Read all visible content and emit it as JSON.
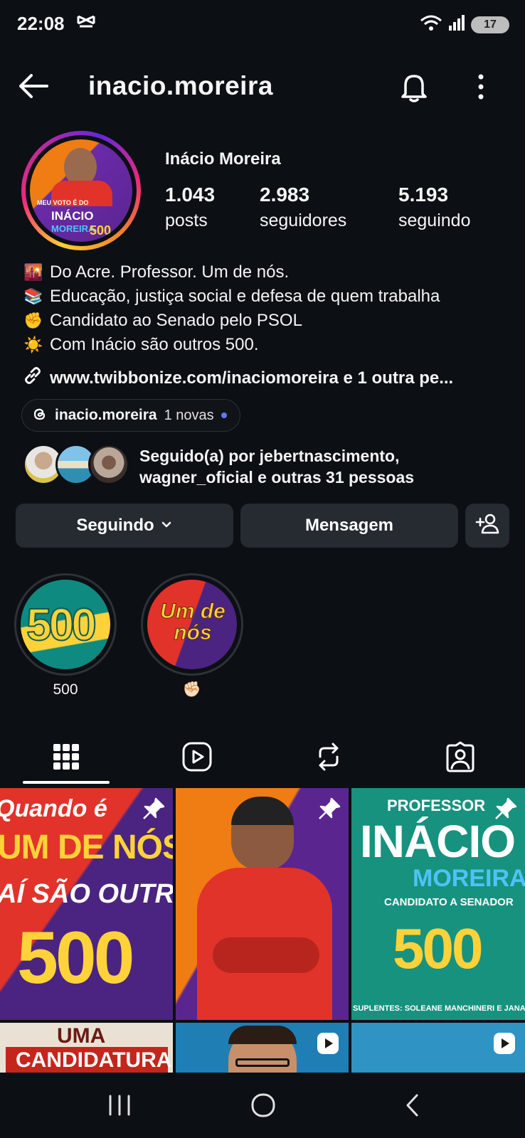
{
  "status_bar": {
    "time": "22:08",
    "app_icon": "capcut-icon",
    "battery": "17"
  },
  "header": {
    "username": "inacio.moreira"
  },
  "profile": {
    "display_name": "Inácio Moreira",
    "stats": [
      {
        "value": "1.043",
        "label": "posts"
      },
      {
        "value": "2.983",
        "label": "seguidores"
      },
      {
        "value": "5.193",
        "label": "seguindo"
      }
    ],
    "avatar_text": {
      "line1": "MEU VOTO É DO",
      "line2": "INÁCIO",
      "line3": "500",
      "line4": "MOREIRA"
    },
    "bio": [
      {
        "emoji": "🌇",
        "text": "Do Acre. Professor. Um de nós."
      },
      {
        "emoji": "📚",
        "text": "Educação, justiça social e defesa de quem trabalha"
      },
      {
        "emoji": "✊",
        "text": "Candidato ao Senado pelo PSOL"
      },
      {
        "emoji": "☀️",
        "text": "Com Inácio são outros 500."
      }
    ],
    "link": "www.twibbonize.com/inaciomoreira e 1 outra pe...",
    "threads": {
      "handle": "inacio.moreira",
      "badge": "1 novas"
    },
    "followed_by": {
      "line1": "Seguido(a) por jebertnascimento,",
      "line2": "wagner_oficial e outras 31 pessoas"
    }
  },
  "actions": {
    "following": "Seguindo",
    "message": "Mensagem"
  },
  "highlights": [
    {
      "label": "500",
      "art": "500"
    },
    {
      "label": "✊🏻",
      "art": "Um de nós"
    }
  ],
  "posts": [
    {
      "lines": [
        "Quando é",
        "UM DE NÓS",
        "AÍ SÃO OUTROS",
        "500"
      ]
    },
    {
      "lines": []
    },
    {
      "lines": [
        "PROFESSOR",
        "INÁCIO",
        "MOREIRA",
        "CANDIDATO A SENADOR",
        "500",
        "SUPLENTES: SOLEANE MANCHINERI E JANAINA QUEIROZ"
      ]
    },
    {
      "lines": [
        "UMA",
        "CANDIDATURA"
      ]
    }
  ],
  "colors": {
    "background": "#0c0f14",
    "button": "#262a31",
    "accent_yellow": "#ffd23a",
    "purple": "#4a2480",
    "red": "#e1332a"
  }
}
